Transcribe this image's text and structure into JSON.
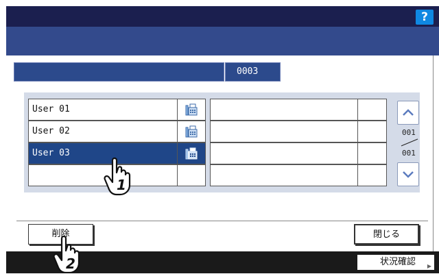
{
  "header": {
    "help_label": "?"
  },
  "info": {
    "counter_value": "0003"
  },
  "list": {
    "rows": [
      {
        "name": "User 01",
        "icon": "fax-icon",
        "selected": false
      },
      {
        "name": "User 02",
        "icon": "fax-icon",
        "selected": false
      },
      {
        "name": "User 03",
        "icon": "fax-icon",
        "selected": true
      },
      {
        "name": "",
        "icon": "",
        "selected": false
      }
    ],
    "pagination": {
      "current": "001",
      "total": "001"
    }
  },
  "actions": {
    "delete_label": "削除",
    "close_label": "閉じる"
  },
  "footer": {
    "status_label": "状況確認"
  },
  "annotations": {
    "step1": "1",
    "step2": "2"
  },
  "colors": {
    "header_bg": "#1b1f4f",
    "title_bg": "#334a8c",
    "selected_row": "#1f4688",
    "panel_bg": "#d4dbe8",
    "help_btn": "#0f88e2"
  }
}
